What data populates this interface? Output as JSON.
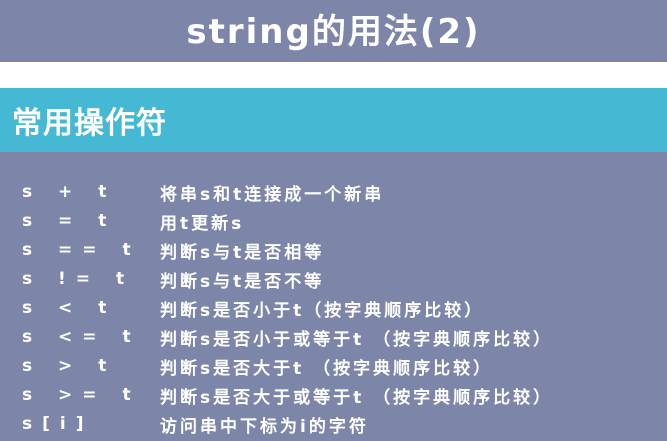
{
  "title": "string的用法(2)",
  "section": "常用操作符",
  "rows": [
    {
      "op": "s + t",
      "desc": "将串s和t连接成一个新串"
    },
    {
      "op": "s = t",
      "desc": "用t更新s"
    },
    {
      "op": "s == t",
      "desc": "判断s与t是否相等"
    },
    {
      "op": "s != t",
      "desc": "判断s与t是否不等"
    },
    {
      "op": "s < t",
      "desc": "判断s是否小于t（按字典顺序比较）"
    },
    {
      "op": "s <= t",
      "desc": "判断s是否小于或等于t （按字典顺序比较）"
    },
    {
      "op": "s > t",
      "desc": "判断s是否大于t （按字典顺序比较）"
    },
    {
      "op": "s >= t",
      "desc": "判断s是否大于或等于t （按字典顺序比较）"
    },
    {
      "op": "s[i]",
      "desc": "访问串中下标为i的字符"
    }
  ]
}
